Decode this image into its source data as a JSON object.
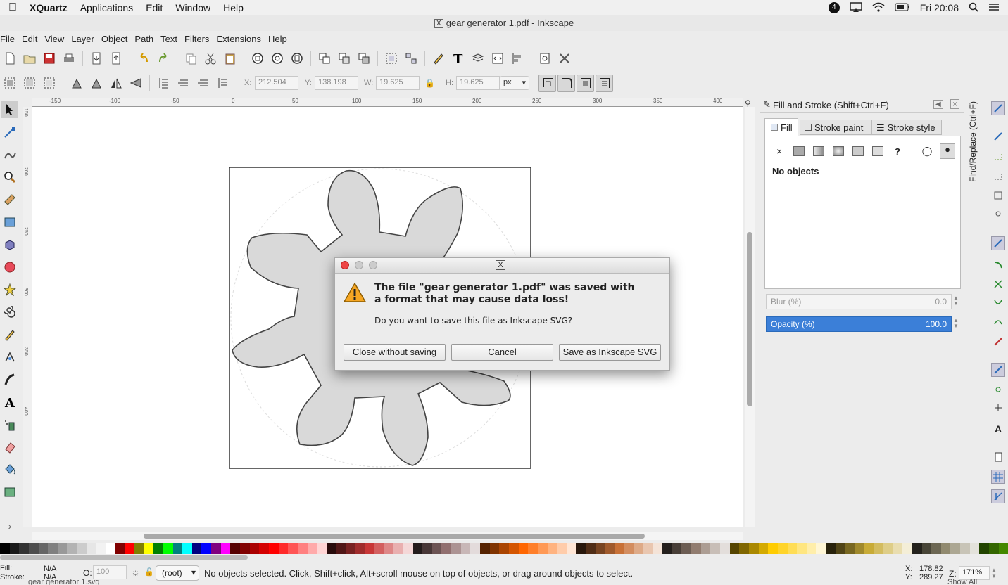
{
  "macbar": {
    "app": "XQuartz",
    "menus": [
      "Applications",
      "Edit",
      "Window",
      "Help"
    ],
    "clock": "Fri 20:08",
    "notification_count": "4"
  },
  "window": {
    "title": "gear generator 1.pdf - Inkscape"
  },
  "menubar": [
    "File",
    "Edit",
    "View",
    "Layer",
    "Object",
    "Path",
    "Text",
    "Filters",
    "Extensions",
    "Help"
  ],
  "toolbar2": {
    "x_label": "X:",
    "x": "212.504",
    "y_label": "Y:",
    "y": "138.198",
    "w_label": "W:",
    "w": "19.625",
    "h_label": "H:",
    "h": "19.625",
    "unit": "px"
  },
  "ruler": [
    "-150",
    "-100",
    "-50",
    "0",
    "50",
    "100",
    "150",
    "200",
    "250",
    "300",
    "350",
    "400"
  ],
  "ruler_left": [
    "150",
    "200",
    "250",
    "300",
    "350",
    "400"
  ],
  "fill_panel": {
    "title": "Fill and Stroke (Shift+Ctrl+F)",
    "tabs": [
      "Fill",
      "Stroke paint",
      "Stroke style"
    ],
    "no_objects": "No objects",
    "blur_label": "Blur (%)",
    "blur": "0.0",
    "opacity_label": "Opacity (%)",
    "opacity": "100.0"
  },
  "find_tab": "Find/Replace (Ctrl+F)",
  "dialog": {
    "heading_line1": "The file \"gear generator 1.pdf\" was saved with",
    "heading_line2": "a format that may cause data loss!",
    "question": "Do you want to save this file as Inkscape SVG?",
    "btn_close": "Close without saving",
    "btn_cancel": "Cancel",
    "btn_save": "Save as Inkscape SVG"
  },
  "status": {
    "fill_label": "Fill:",
    "fill": "N/A",
    "stroke_label": "Stroke:",
    "stroke": "N/A",
    "o_label": "O:",
    "o": "100",
    "layer": "(root)",
    "message": "No objects selected. Click, Shift+click, Alt+scroll mouse on top of objects, or drag around objects to select.",
    "x_label": "X:",
    "x": "178.82",
    "y_label": "Y:",
    "y": "289.27",
    "z_label": "Z:",
    "zoom": "171%",
    "dock_left": "gear generator 1.svg",
    "dock_right": "Show All"
  },
  "colors": {
    "palette": [
      "#000000",
      "#1a1a1a",
      "#333333",
      "#4d4d4d",
      "#666666",
      "#808080",
      "#999999",
      "#b3b3b3",
      "#cccccc",
      "#e6e6e6",
      "#f2f2f2",
      "#ffffff",
      "#800000",
      "#ff0000",
      "#808000",
      "#ffff00",
      "#008000",
      "#00ff00",
      "#008080",
      "#00ffff",
      "#000080",
      "#0000ff",
      "#800080",
      "#ff00ff",
      "#550000",
      "#800000",
      "#aa0000",
      "#d40000",
      "#ff0000",
      "#ff2a2a",
      "#ff5555",
      "#ff8080",
      "#ffaaaa",
      "#ffd5d5",
      "#280b0b",
      "#501616",
      "#782121",
      "#a02c2c",
      "#c83737",
      "#d35f5f",
      "#de8787",
      "#e9afaf",
      "#f4d7d7",
      "#241c1c",
      "#483737",
      "#6c5353",
      "#916f6f",
      "#ac9393",
      "#c8b7b7",
      "#e3dbdb",
      "#552200",
      "#803300",
      "#aa4400",
      "#d45500",
      "#ff6600",
      "#ff7f2a",
      "#ff9955",
      "#ffb380",
      "#ffccaa",
      "#ffe6d5",
      "#28170b",
      "#502d16",
      "#784421",
      "#a05a2c",
      "#c87137",
      "#d38d5f",
      "#deaa87",
      "#e9c6af",
      "#f4e3d7",
      "#241f1c",
      "#483e37",
      "#6c5d53",
      "#917c6f",
      "#ac9d93",
      "#c8beb7",
      "#e3dedb",
      "#554400",
      "#806600",
      "#aa8800",
      "#d4aa00",
      "#ffcc00",
      "#ffd42a",
      "#ffdd55",
      "#ffe680",
      "#ffeeaa",
      "#fff6d5",
      "#28220b",
      "#504416",
      "#786721",
      "#a0892c",
      "#c8ab37",
      "#d3bc5f",
      "#decd87",
      "#e9ddaf",
      "#f4eed7",
      "#24221c",
      "#484537",
      "#6c6753",
      "#918a6f",
      "#aca793",
      "#c8c4b7",
      "#e3e2db",
      "#224400",
      "#336600",
      "#448800"
    ],
    "accent_blue": "#3b7fd8",
    "gear_fill": "#d9d9d9",
    "gear_stroke": "#444444"
  },
  "icons": {
    "warning": "warning-triangle-icon",
    "x11": "x11-logo-icon"
  }
}
